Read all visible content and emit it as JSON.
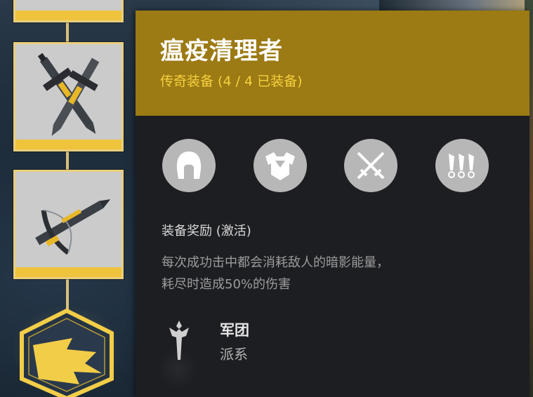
{
  "tooltip": {
    "title": "瘟疫清理者",
    "subtitle": "传奇装备 (4 / 4 已装备)",
    "gear_icons": [
      "helmet-icon",
      "chest-armor-icon",
      "crossed-swords-icon",
      "throwing-knives-icon"
    ],
    "bonus_heading": "装备奖励 (激活)",
    "bonus_line_1": "每次成功击中都会消耗敌人的暗影能量，",
    "bonus_line_2": "耗尽时造成50%的伤害",
    "faction_name": "军团",
    "faction_type": "派系"
  },
  "colors": {
    "header_gold": "#9c7a14",
    "subtitle_yellow": "#f6d23e",
    "panel_bg": "#1d1e22",
    "slot_border": "#e9cf7d",
    "slot_bar": "#f0c33d"
  }
}
